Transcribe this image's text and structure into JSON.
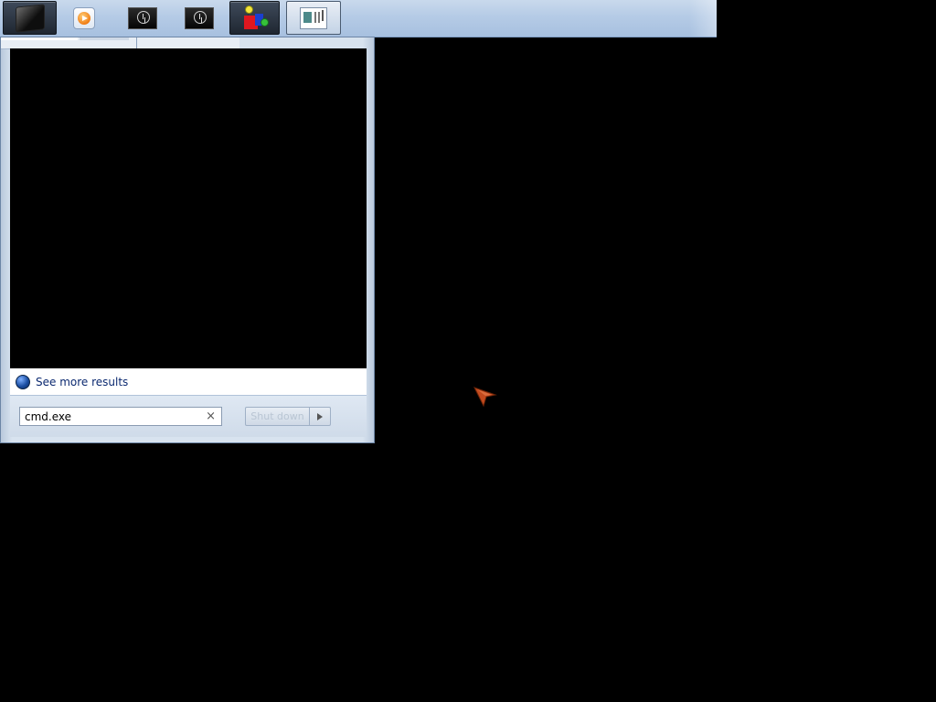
{
  "taskbar": {
    "buttons": [
      {
        "name": "monitor-icon",
        "active": true
      },
      {
        "name": "media-player-icon",
        "active": false
      },
      {
        "name": "clock-icon",
        "active": false
      },
      {
        "name": "clock-icon",
        "active": false
      },
      {
        "name": "shapes-icon",
        "active": true
      },
      {
        "name": "document-icon",
        "active": true
      }
    ]
  },
  "start_menu": {
    "see_more_results": "See more results",
    "search": {
      "value": "cmd.exe",
      "clear_glyph": "×"
    },
    "shutdown_label": "Shut down"
  },
  "colors": {
    "desktop_background": "#000000",
    "taskbar": "#b5cbe6",
    "panel": "#d8e3ef",
    "link_text": "#0b2970",
    "cursor": "#c24a1e"
  }
}
